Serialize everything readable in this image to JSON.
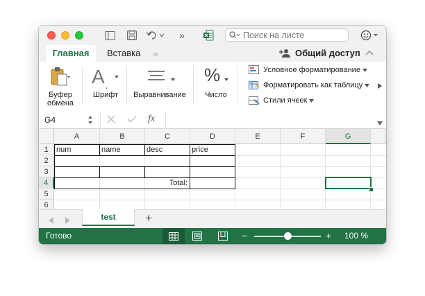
{
  "titlebar": {
    "search_placeholder": "Поиск на листе",
    "icons": [
      "sidebar-icon",
      "save-icon",
      "undo-icon",
      "more-icon",
      "excel-icon",
      "search-icon",
      "smiley-icon"
    ]
  },
  "tabs": {
    "home": "Главная",
    "insert": "Вставка",
    "more": "»",
    "share": "Общий доступ"
  },
  "ribbon": {
    "clipboard": "Буфер обмена",
    "font": "Шрифт",
    "alignment": "Выравнивание",
    "number": "Число",
    "number_symbol": "%",
    "font_symbol": "A",
    "conditional": "Условное форматирование",
    "format_table": "Форматировать как таблицу",
    "cell_styles": "Стили ячеек"
  },
  "formula_bar": {
    "name_box": "G4",
    "fx": "fx",
    "value": ""
  },
  "grid": {
    "columns": [
      "A",
      "B",
      "C",
      "D",
      "E",
      "F",
      "G"
    ],
    "rows": [
      "1",
      "2",
      "3",
      "4",
      "5",
      "6"
    ],
    "headers": {
      "a1": "num",
      "b1": "name",
      "c1": "desc",
      "d1": "price"
    },
    "total_label": "Total:"
  },
  "sheets": {
    "active": "test",
    "add": "+"
  },
  "status": {
    "ready": "Готово",
    "minus": "−",
    "plus": "+",
    "zoom": "100 %",
    "zoom_level": 0.5
  },
  "colors": {
    "accent": "#217346",
    "tab_active_text": "#1f7244",
    "selection": "#217346"
  }
}
